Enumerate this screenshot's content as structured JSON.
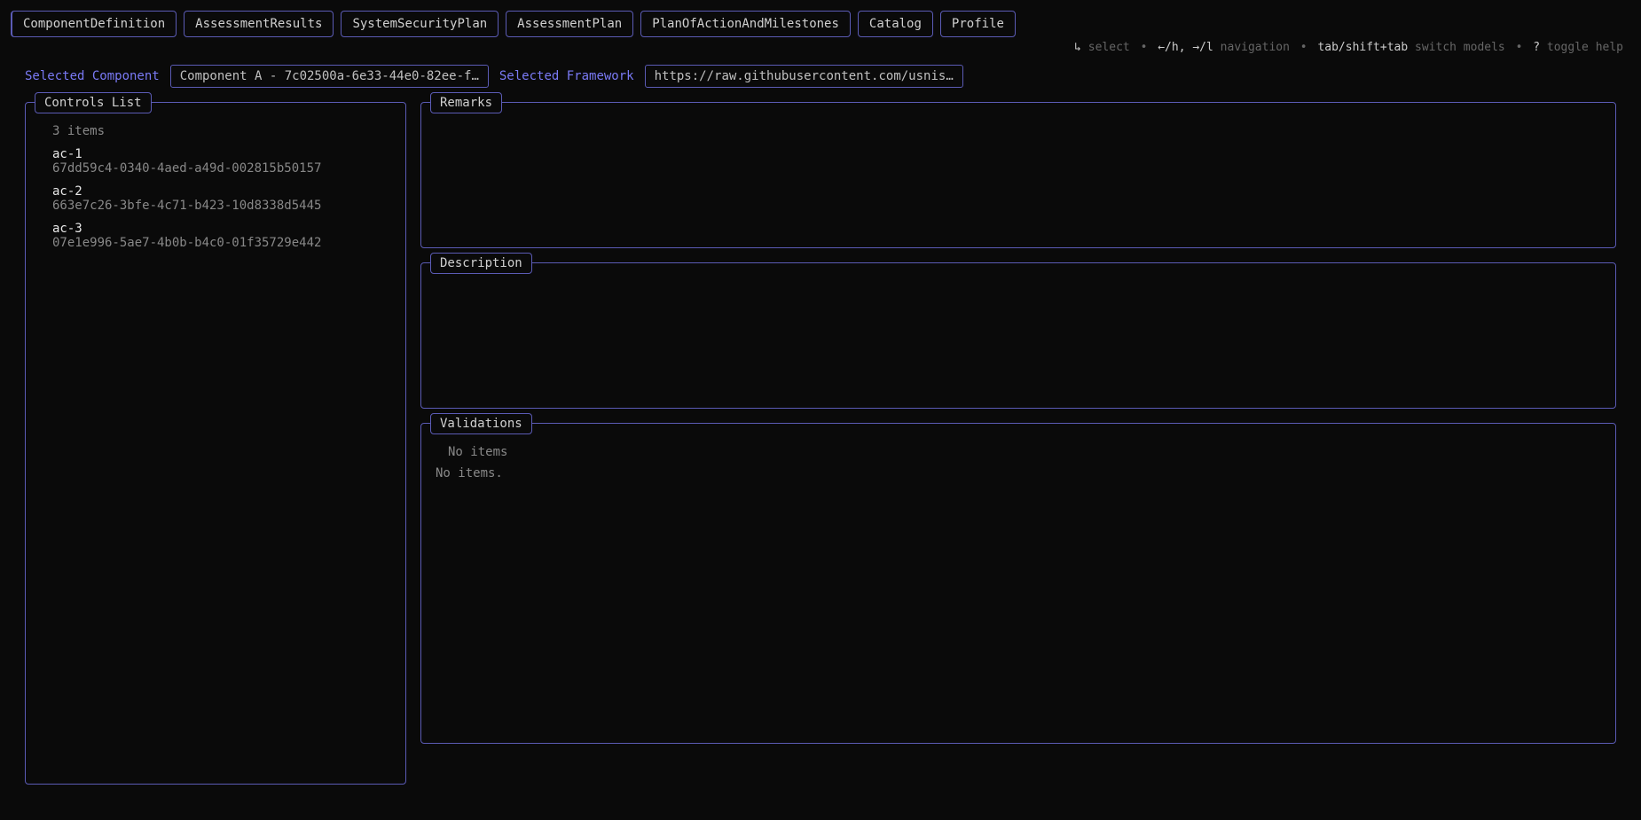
{
  "tabs": [
    {
      "label": "ComponentDefinition",
      "active": true
    },
    {
      "label": "AssessmentResults",
      "active": false
    },
    {
      "label": "SystemSecurityPlan",
      "active": false
    },
    {
      "label": "AssessmentPlan",
      "active": false
    },
    {
      "label": "PlanOfActionAndMilestones",
      "active": false
    },
    {
      "label": "Catalog",
      "active": false
    },
    {
      "label": "Profile",
      "active": false
    }
  ],
  "hints": {
    "select_key": "↳",
    "select_label": "select",
    "nav_key": "←/h, →/l",
    "nav_label": "navigation",
    "switch_key": "tab/shift+tab",
    "switch_label": "switch models",
    "help_key": "?",
    "help_label": "toggle help"
  },
  "selectors": {
    "component_label": "Selected Component",
    "component_value": "Component A - 7c02500a-6e33-44e0-82ee-f…",
    "framework_label": "Selected Framework",
    "framework_value": "https://raw.githubusercontent.com/usnis…"
  },
  "controls_panel": {
    "title": "Controls List",
    "count_text": "3 items",
    "items": [
      {
        "id": "ac-1",
        "uuid": "67dd59c4-0340-4aed-a49d-002815b50157"
      },
      {
        "id": "ac-2",
        "uuid": "663e7c26-3bfe-4c71-b423-10d8338d5445"
      },
      {
        "id": "ac-3",
        "uuid": "07e1e996-5ae7-4b0b-b4c0-01f35729e442"
      }
    ]
  },
  "remarks_panel": {
    "title": "Remarks"
  },
  "description_panel": {
    "title": "Description"
  },
  "validations_panel": {
    "title": "Validations",
    "count_text": "No items",
    "body_text": "No items."
  }
}
